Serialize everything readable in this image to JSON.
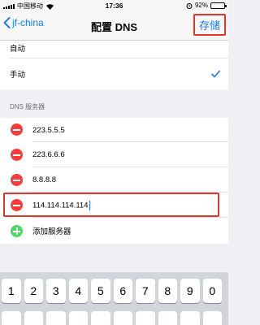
{
  "status_bar": {
    "carrier": "中国移动",
    "time": "17:36",
    "battery": "92%"
  },
  "nav": {
    "back_label": "jf-china",
    "title": "配置 DNS",
    "save_label": "存储"
  },
  "modes": {
    "auto": "自动",
    "manual": "手动"
  },
  "dns_section": {
    "header": "DNS 服务器",
    "servers": [
      "223.5.5.5",
      "223.6.6.6",
      "8.8.8.8"
    ],
    "editing_value": "114.114.114.114",
    "add_label": "添加服务器"
  },
  "keyboard": {
    "keys": [
      "1",
      "2",
      "3",
      "4",
      "5",
      "6",
      "7",
      "8",
      "9",
      "0"
    ]
  },
  "colors": {
    "accent": "#1a7cf5",
    "delete": "#fa3d3a",
    "add": "#4cd964",
    "annotation": "#e2352b"
  }
}
